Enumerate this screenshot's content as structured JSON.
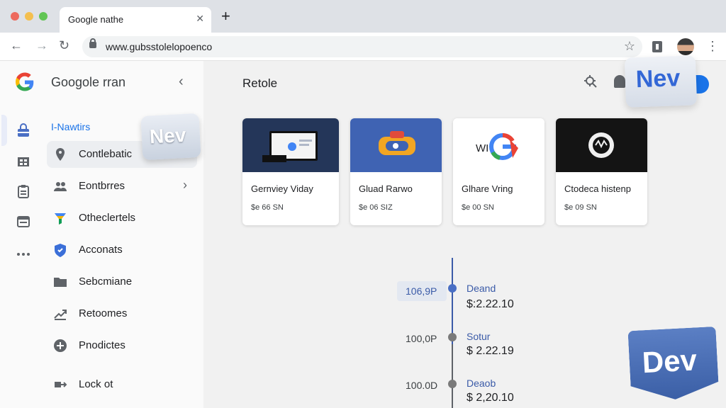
{
  "browser": {
    "tab_title": "Google nathe",
    "tab_close": "✕",
    "new_tab": "+",
    "url": "www.gubsstolelopoenco"
  },
  "sidebar": {
    "app_title": "Googole rran",
    "collapse_icon": "‹",
    "items": [
      {
        "label": "I-Nawtirs",
        "icon": "bag-icon"
      },
      {
        "label": "Contlebatic",
        "icon": "location-pin-icon"
      },
      {
        "label": "Eontbrres",
        "icon": "people-icon"
      },
      {
        "label": "Otheclertels",
        "icon": "funnel-icon"
      },
      {
        "label": "Acconats",
        "icon": "shield-icon"
      },
      {
        "label": "Sebcmiane",
        "icon": "folder-icon"
      },
      {
        "label": "Retoomes",
        "icon": "trend-icon"
      },
      {
        "label": "Pnodictes",
        "icon": "add-circle-icon"
      },
      {
        "label": "Lock ot",
        "icon": "logout-icon"
      }
    ],
    "chevron": "›",
    "badge": "Nev"
  },
  "main": {
    "title": "Retole",
    "badge_top": "Nev",
    "badge_bottom": "Dev",
    "cards": [
      {
        "name": "Gernviey Viday",
        "price": "$e 66 SN"
      },
      {
        "name": "Gluad Rarwo",
        "price": "$e 06 SIZ"
      },
      {
        "name": "Glhare Vring",
        "price": "$e 00 SN"
      },
      {
        "name": "Ctodeca histenp",
        "price": "$e 09 SN"
      }
    ],
    "timeline": [
      {
        "left": "106,9P",
        "label": "Deand",
        "price": "$:2.22.10"
      },
      {
        "left": "100,0P",
        "label": "Sotur",
        "price": "$ 2.22.19"
      },
      {
        "left": "100.0D",
        "label": "Deaob",
        "price": "$ 2,20.10"
      }
    ]
  },
  "colors": {
    "accent": "#1a73e8",
    "timeline_active": "#3b5ba8",
    "badge_blue": "#4a6fc4"
  }
}
